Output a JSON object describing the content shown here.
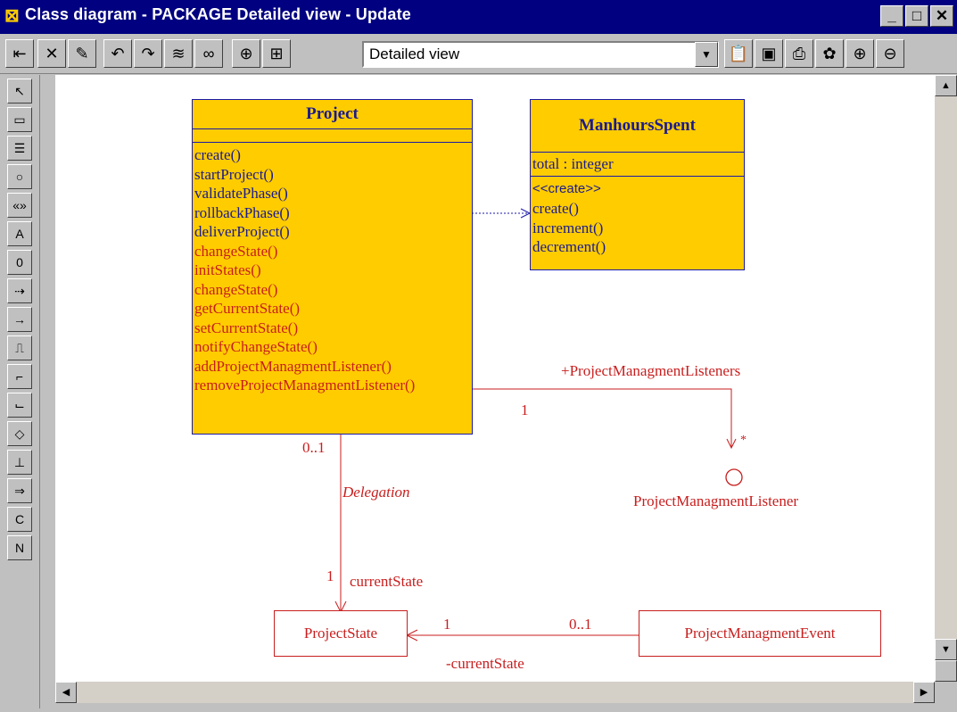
{
  "window": {
    "title": "Class diagram - PACKAGE  Detailed view - Update",
    "controls": [
      "minimize-icon",
      "maximize-icon",
      "close-icon"
    ]
  },
  "toolbar": {
    "view_select_value": "Detailed view",
    "buttons": [
      "exit-icon",
      "delete-icon",
      "edit-icon",
      "undo-icon",
      "redo-icon",
      "wireless-icon",
      "search-icon",
      "target-icon",
      "tree-icon",
      "clipboard-icon",
      "window-icon",
      "print-icon",
      "palette-icon",
      "zoom-in-icon",
      "zoom-out-icon"
    ]
  },
  "palette": {
    "tools": [
      "pointer-icon",
      "class-icon",
      "list-icon",
      "circle-icon",
      "stereotype-icon",
      "attribute-icon",
      "operation-icon",
      "dependency-icon",
      "arrow-icon",
      "step-icon",
      "bracket-icon",
      "down-step-icon",
      "diamond-icon",
      "ruler-icon",
      "right-arrow-icon",
      "c-icon",
      "n-icon"
    ]
  },
  "diagram": {
    "project": {
      "name": "Project",
      "operations_blue": [
        "create()",
        "startProject()",
        "validatePhase()",
        "rollbackPhase()",
        "deliverProject()"
      ],
      "operations_red": [
        "changeState()",
        "initStates()",
        "changeState()",
        "getCurrentState()",
        "setCurrentState()",
        "notifyChangeState()",
        "addProjectManagmentListener()",
        "removeProjectManagmentListener()"
      ]
    },
    "manhours": {
      "name": "ManhoursSpent",
      "attribute": "total : integer",
      "stereotype": "<<create>>",
      "operations": [
        "create()",
        "increment()",
        "decrement()"
      ]
    },
    "project_state": "ProjectState",
    "project_event": "ProjectManagmentEvent",
    "interface_name": "ProjectManagmentListener",
    "labels": {
      "listeners_role": "+ProjectManagmentListeners",
      "listeners_mult_src": "1",
      "listeners_mult_dst": "*",
      "delegation_src_mult": "0..1",
      "delegation": "Delegation",
      "delegation_dst_mult": "1",
      "current_state_role": "currentState",
      "event_mult_dst": "1",
      "event_mult_src": "0..1",
      "event_role": "-currentState"
    },
    "colors": {
      "class_fill": "#ffcc00",
      "class_border": "#1a1aa8",
      "association": "#c81e1e"
    }
  }
}
